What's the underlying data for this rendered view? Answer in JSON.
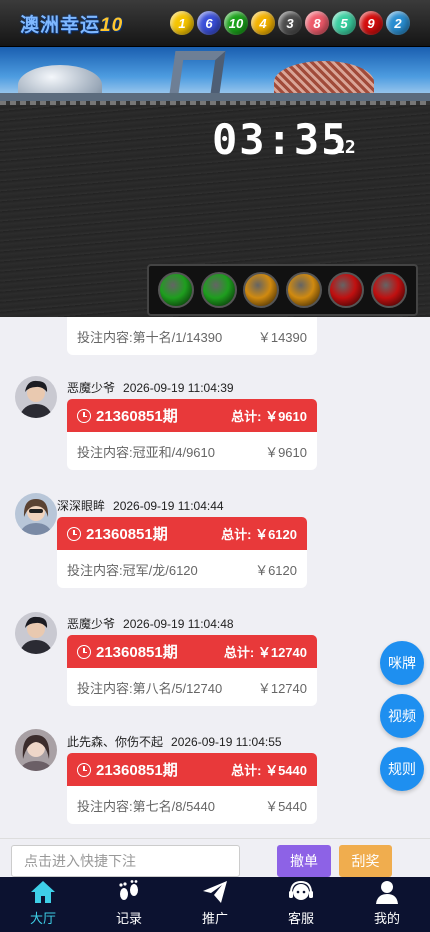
{
  "header": {
    "title_main": "澳洲幸运",
    "title_num": "10",
    "balls": [
      {
        "num": "1",
        "color": "#f5c400"
      },
      {
        "num": "6",
        "color": "#3a4fd9"
      },
      {
        "num": "10",
        "color": "#1aa11a"
      },
      {
        "num": "4",
        "color": "#f3b200"
      },
      {
        "num": "3",
        "color": "#4d4d4d"
      },
      {
        "num": "8",
        "color": "#ee5a6a"
      },
      {
        "num": "5",
        "color": "#3acfa0"
      },
      {
        "num": "9",
        "color": "#d40d0d"
      },
      {
        "num": "2",
        "color": "#2a8ed1"
      }
    ]
  },
  "scoreboard": {
    "countdown": "03:35",
    "sub": "12",
    "lights": [
      {
        "color": "#1e9e1e"
      },
      {
        "color": "#1e9e1e"
      },
      {
        "color": "#d08a10"
      },
      {
        "color": "#d08a10"
      },
      {
        "color": "#c01010"
      },
      {
        "color": "#c01010"
      }
    ]
  },
  "feed": {
    "partial": {
      "content": "投注内容:第十名/1/14390",
      "amount": "￥14390"
    },
    "entries": [
      {
        "user": "恶魔少爷",
        "time": "2026-09-19 11:04:39",
        "period": "21360851期",
        "total": "总计: ￥9610",
        "content": "投注内容:冠亚和/4/9610",
        "amount": "￥9610"
      },
      {
        "user": "深深眼眸",
        "time": "2026-09-19 11:04:44",
        "period": "21360851期",
        "total": "总计: ￥6120",
        "content": "投注内容:冠军/龙/6120",
        "amount": "￥6120"
      },
      {
        "user": "恶魔少爷",
        "time": "2026-09-19 11:04:48",
        "period": "21360851期",
        "total": "总计: ￥12740",
        "content": "投注内容:第八名/5/12740",
        "amount": "￥12740"
      },
      {
        "user": "此先森、你伤不起",
        "time": "2026-09-19 11:04:55",
        "period": "21360851期",
        "total": "总计: ￥5440",
        "content": "投注内容:第七名/8/5440",
        "amount": "￥5440"
      }
    ]
  },
  "float_buttons": {
    "squeeze": "咪牌",
    "video": "视频",
    "rules": "规则"
  },
  "quickbar": {
    "placeholder": "点击进入快捷下注",
    "undo": "撤单",
    "scratch": "刮奖"
  },
  "tabs": [
    {
      "label": "大厅",
      "icon": "home-icon",
      "active": true
    },
    {
      "label": "记录",
      "icon": "footprint-icon",
      "active": false
    },
    {
      "label": "推广",
      "icon": "paper-plane-icon",
      "active": false
    },
    {
      "label": "客服",
      "icon": "headset-icon",
      "active": false
    },
    {
      "label": "我的",
      "icon": "user-icon",
      "active": false
    }
  ]
}
